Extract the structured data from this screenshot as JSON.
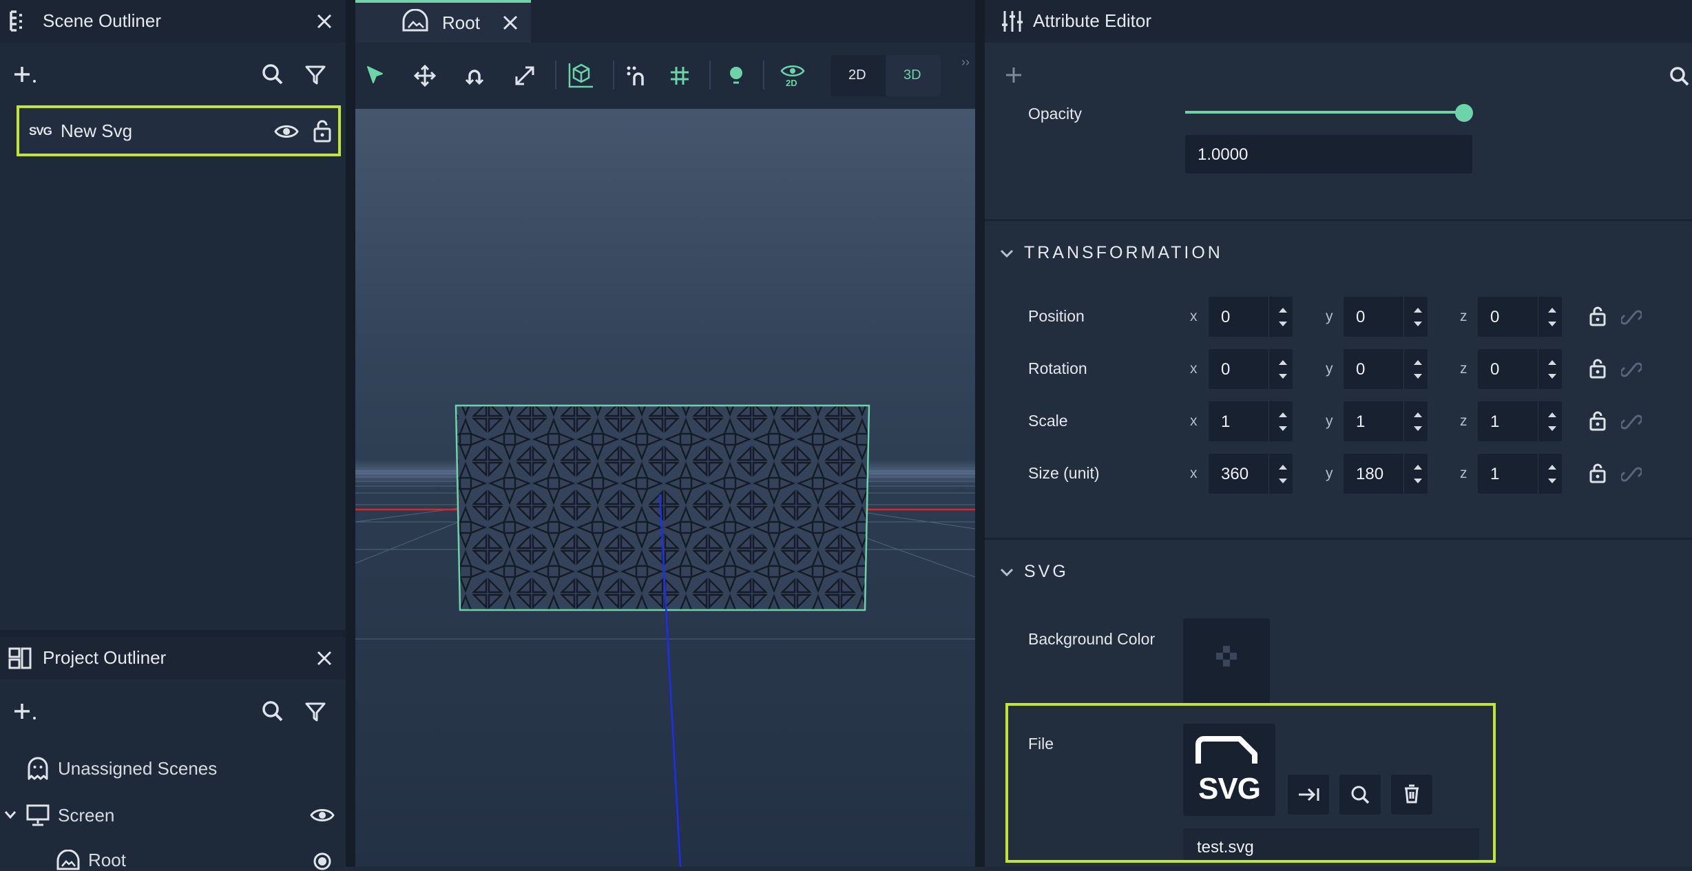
{
  "scene_outliner": {
    "title": "Scene Outliner",
    "items": [
      {
        "badge": "SVG",
        "label": "New Svg"
      }
    ]
  },
  "project_outliner": {
    "title": "Project Outliner",
    "items": [
      {
        "label": "Unassigned Scenes",
        "icon": "ghost-icon"
      },
      {
        "label": "Screen",
        "icon": "monitor-icon"
      },
      {
        "label": "Root",
        "icon": "scene-icon"
      }
    ]
  },
  "viewport": {
    "tab_label": "Root",
    "dim_2d": "2D",
    "dim_3d": "3D",
    "active_dim": "3D",
    "eye_badge": "2D",
    "colors": {
      "accent": "#6dd3a8",
      "x_axis": "#e0242a",
      "y_axis": "#1b2ff0",
      "selection": "#6dd3a8"
    }
  },
  "attribute_editor": {
    "title": "Attribute Editor",
    "opacity": {
      "label": "Opacity",
      "value": "1.0000",
      "level": 1.0
    },
    "transformation": {
      "title": "TRANSFORMATION",
      "rows": [
        {
          "label": "Position",
          "x": "0",
          "y": "0",
          "z": "0"
        },
        {
          "label": "Rotation",
          "x": "0",
          "y": "0",
          "z": "0"
        },
        {
          "label": "Scale",
          "x": "1",
          "y": "1",
          "z": "1"
        },
        {
          "label": "Size (unit)",
          "x": "360",
          "y": "180",
          "z": "1"
        }
      ],
      "axis_x": "x",
      "axis_y": "y",
      "axis_z": "z"
    },
    "svg": {
      "title": "SVG",
      "background_color_label": "Background Color",
      "file_label": "File",
      "file_name": "test.svg",
      "file_badge": "SVG"
    }
  },
  "colors": {
    "highlight": "#c2e62f",
    "accent": "#6dd3a8"
  }
}
